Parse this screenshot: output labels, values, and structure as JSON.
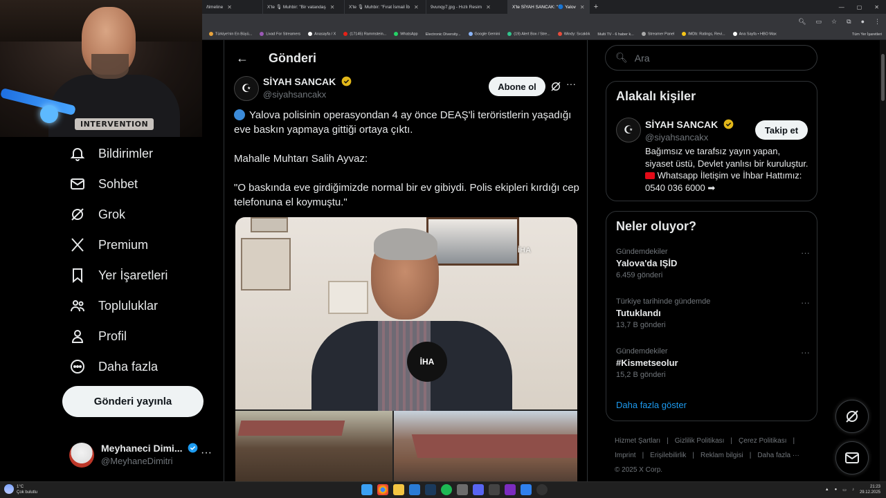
{
  "webcam": {
    "shirt_text": "INTERVENTION"
  },
  "browser": {
    "tabs": [
      {
        "label": "/timeline",
        "active": false
      },
      {
        "label": "X'te 🎙 Muhbir: \"Bir vatandaş",
        "active": false
      },
      {
        "label": "X'te 🎙 Muhbir: \"Fırat İsmail İb",
        "active": false
      },
      {
        "label": "9vunqy7.jpg - Hızlı Resim",
        "active": false
      },
      {
        "label": "X'te SİYAH SANCAK: \"🔵 Yalov",
        "active": true
      }
    ],
    "bookmarks": [
      "Türkiye'nin En Büyü...",
      "Livad For Streamers",
      "Anasayfa / X",
      "(17145) Rammstein...",
      "WhatsApp",
      "Electronic Diversity...",
      "Google Gemini",
      "(19) Alert Box / Stre...",
      "Windy: Sıcaklık",
      "Multi TV - 6 haber k...",
      "Streamer Panel",
      "IMDb: Ratings, Revi...",
      "Ana Sayfa • HBO Max"
    ],
    "bookmarks_all": "Tüm Yer İşaretleri"
  },
  "nav": {
    "items": [
      {
        "label": "Bildirimler",
        "icon": "bell-icon"
      },
      {
        "label": "Sohbet",
        "icon": "mail-icon"
      },
      {
        "label": "Grok",
        "icon": "grok-icon"
      },
      {
        "label": "Premium",
        "icon": "x-logo-icon"
      },
      {
        "label": "Yer İşaretleri",
        "icon": "bookmark-icon"
      },
      {
        "label": "Topluluklar",
        "icon": "people-icon"
      },
      {
        "label": "Profil",
        "icon": "person-icon"
      },
      {
        "label": "Daha fazla",
        "icon": "more-circle-icon"
      }
    ],
    "post_button": "Gönderi yayınla",
    "account": {
      "name": "Meyhaneci Dimi...",
      "handle": "@MeyhaneDimitri",
      "more": "···"
    }
  },
  "main": {
    "title": "Gönderi",
    "author": {
      "name": "SİYAH SANCAK",
      "handle": "@siyahsancakx"
    },
    "subscribe_label": "Abone ol",
    "more": "···",
    "tweet": {
      "line1": "Yalova polisinin operasyondan 4 ay önce DEAŞ'li teröristlerin yaşadığı eve baskın yapmaya gittiği ortaya çıktı.",
      "line2": "Mahalle Muhtarı Salih Ayvaz:",
      "line3": "\"O baskında eve girdiğimizde normal bir ev gibiydi. Polis ekipleri kırdığı cep telefonuna el koymuştu.\""
    },
    "media": {
      "watermark": "İHA",
      "mic_label": "İHA"
    }
  },
  "right": {
    "search_placeholder": "Ara",
    "related": {
      "title": "Alakalı kişiler",
      "name": "SİYAH SANCAK",
      "handle": "@siyahsancakx",
      "follow_label": "Takip et",
      "bio_part1": "Bağımsız ve tarafsız yayın yapan, siyaset üstü, Devlet yanlısı bir kuruluştur.",
      "bio_part2": "Whatsapp İletişim ve İhbar Hattımız: 0540 036 6000"
    },
    "trends": {
      "title": "Neler oluyor?",
      "items": [
        {
          "category": "Gündemdekiler",
          "topic": "Yalova'da IŞİD",
          "count": "6.459 gönderi"
        },
        {
          "category": "Türkiye tarihinde gündemde",
          "topic": "Tutuklandı",
          "count": "13,7 B gönderi"
        },
        {
          "category": "Gündemdekiler",
          "topic": "#Kismetseolur",
          "count": "15,2 B gönderi"
        }
      ],
      "show_more": "Daha fazla göster"
    },
    "footer": {
      "links": [
        "Hizmet Şartları",
        "|",
        "Gizlilik Politikası",
        "|",
        "Çerez Politikası",
        "|",
        "Imprint",
        "|",
        "Erişilebilirlik",
        "|",
        "Reklam bilgisi",
        "|",
        "Daha fazla ···"
      ],
      "copyright": "© 2025 X Corp."
    }
  },
  "taskbar": {
    "temp": "1°C",
    "weather": "Çok bulutlu",
    "time": "21:23",
    "date": "29.12.2025"
  }
}
